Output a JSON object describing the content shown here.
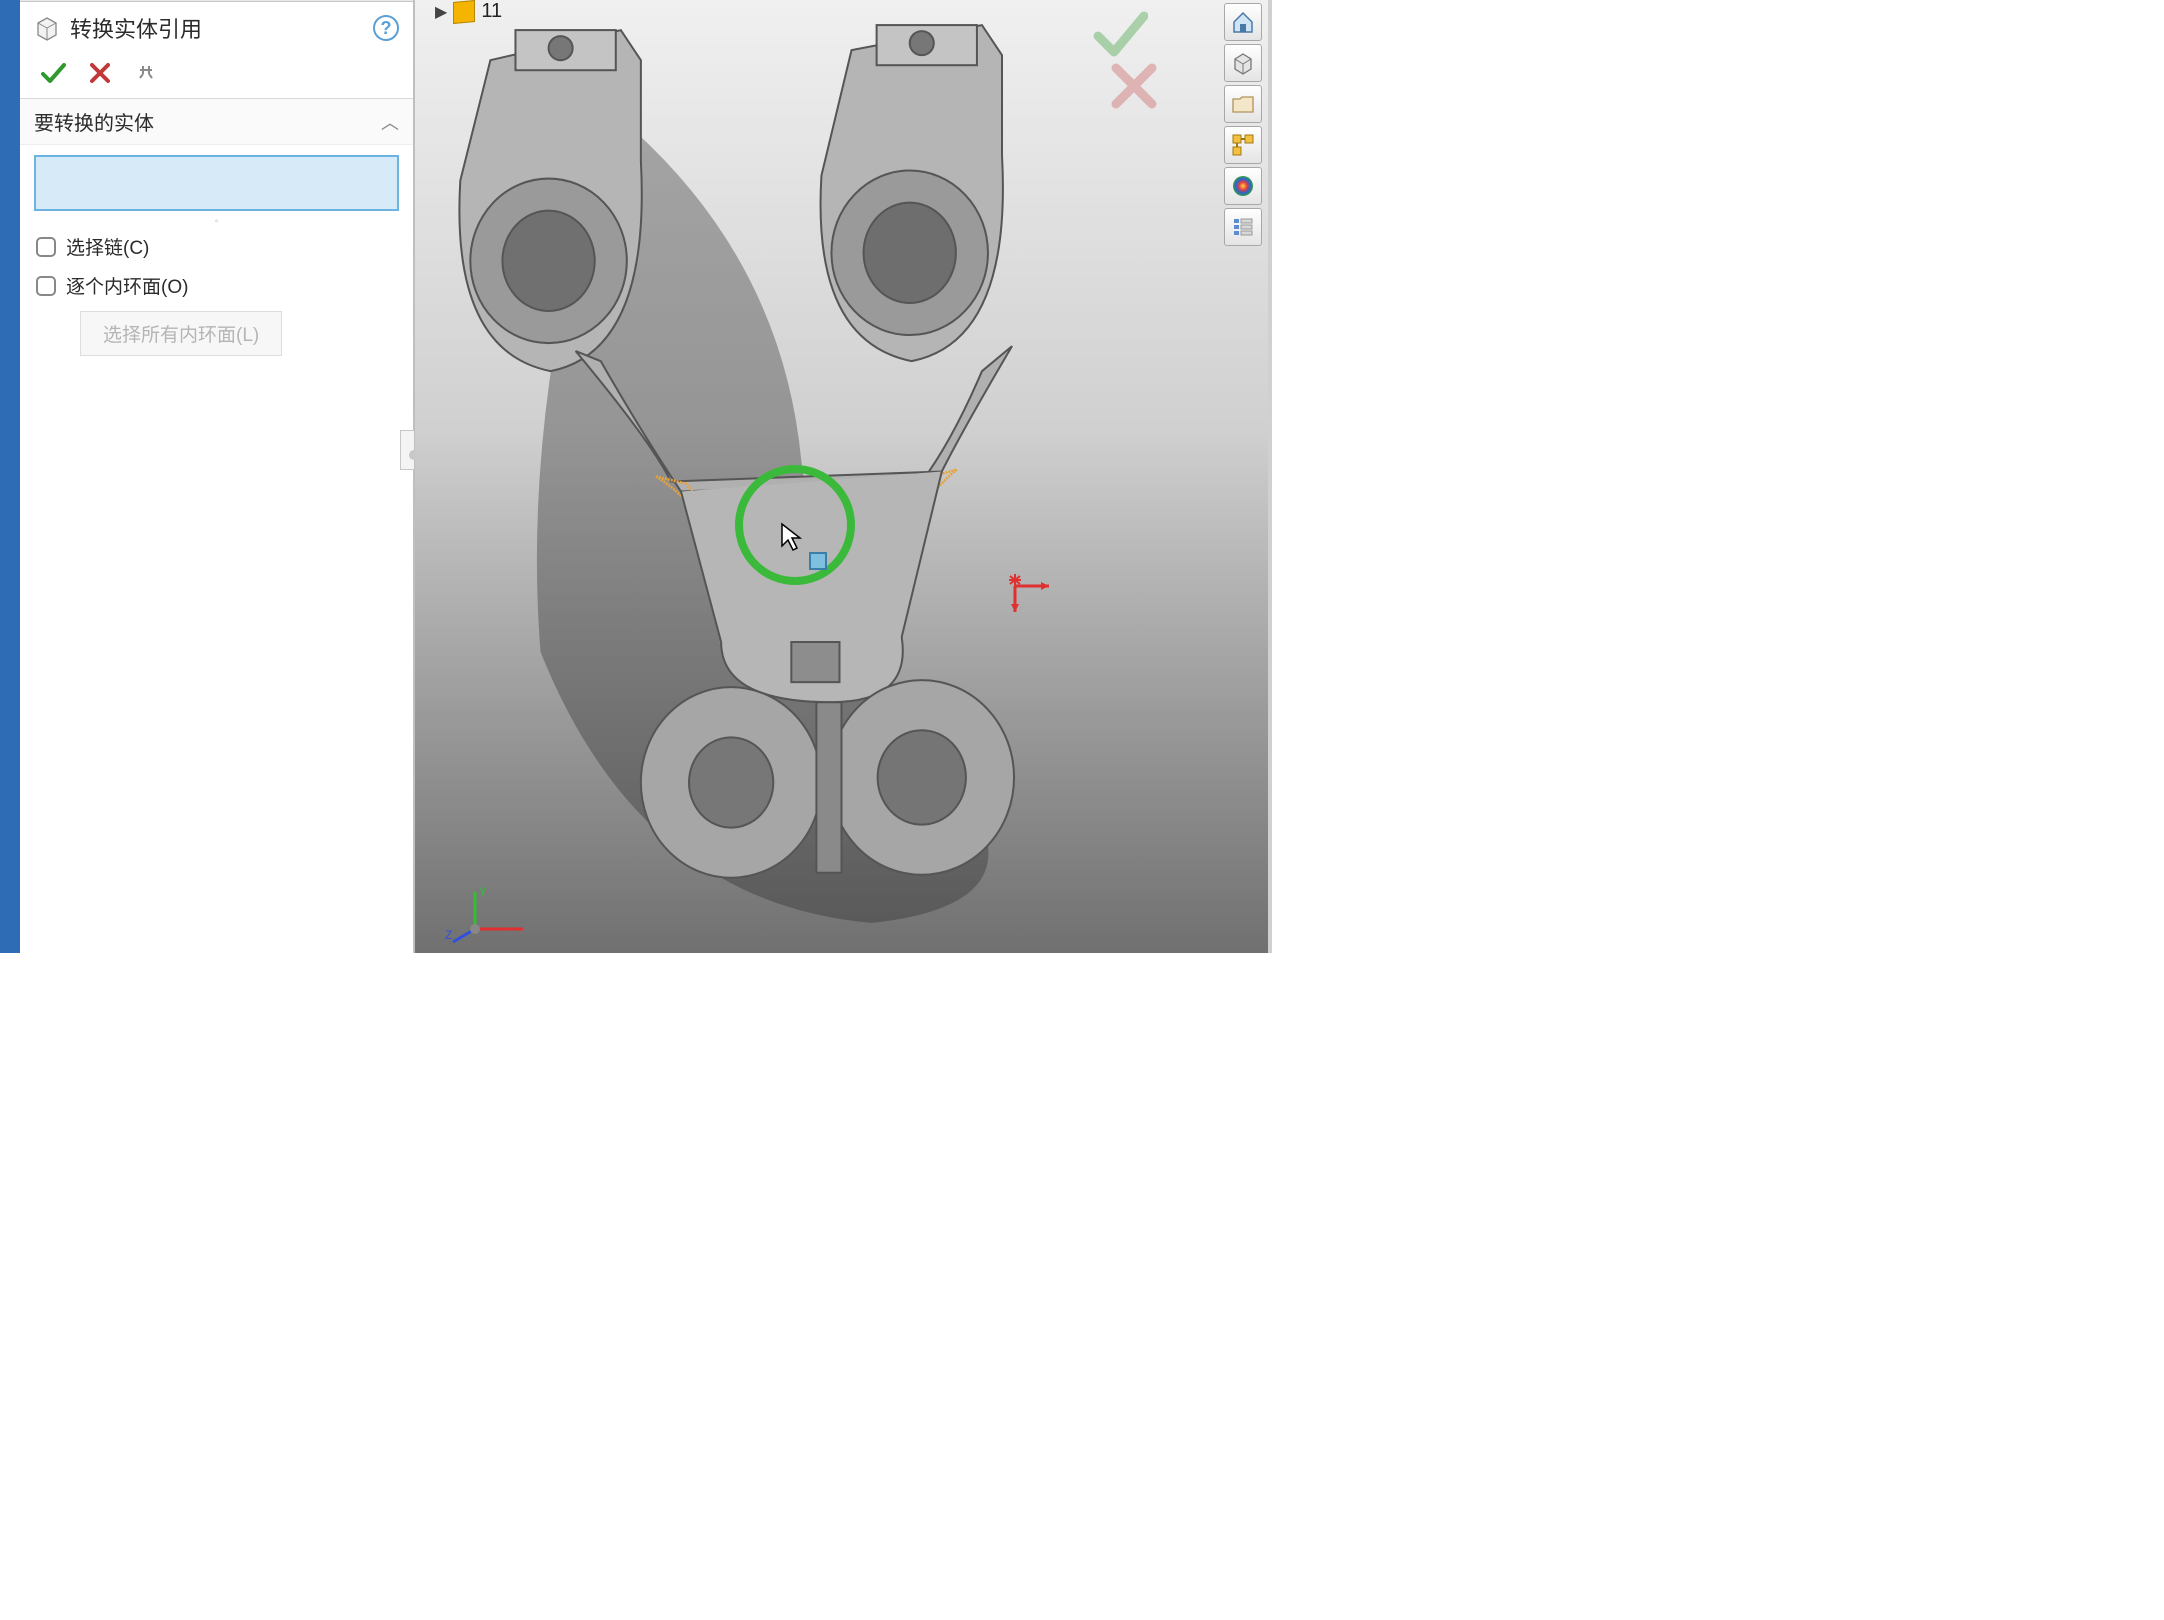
{
  "panel": {
    "title": "转换实体引用",
    "help_tooltip": "?",
    "group_title": "要转换的实体",
    "select_chain_label": "选择链(C)",
    "inner_loop_label": "逐个内环面(O)",
    "select_all_inner_label": "选择所有内环面(L)"
  },
  "viewport": {
    "folder_number": "11"
  },
  "colors": {
    "ok_green": "#2e9a2e",
    "cancel_red": "#c23838",
    "highlight_green": "#3bb93b",
    "face_select": "#e6b24d"
  }
}
